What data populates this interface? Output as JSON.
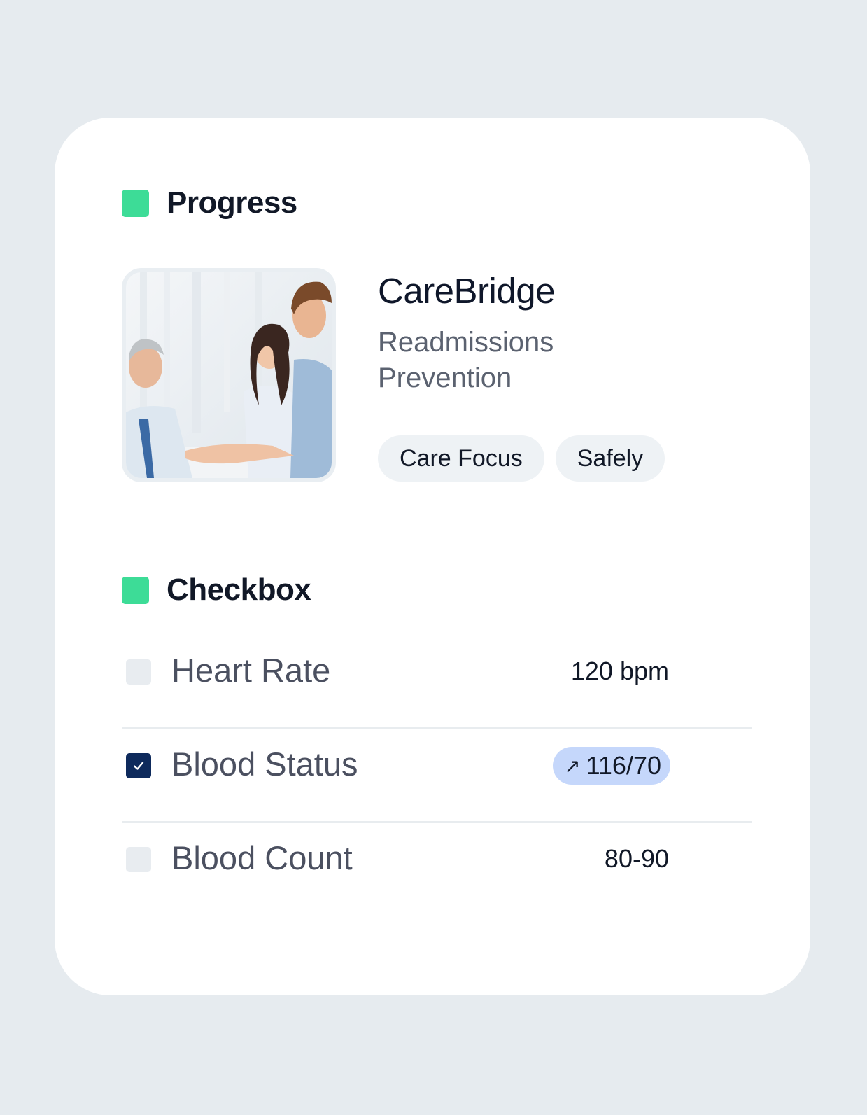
{
  "progress_section": {
    "title": "Progress",
    "app_title": "CareBridge",
    "subtitle_line1": "Readmissions",
    "subtitle_line2": "Prevention",
    "tags": [
      "Care Focus",
      "Safely"
    ]
  },
  "checkbox_section": {
    "title": "Checkbox",
    "items": [
      {
        "label": "Heart Rate",
        "value": "120 bpm",
        "checked": false
      },
      {
        "label": "Blood Status",
        "value": "116/70",
        "checked": true,
        "trend_icon": "arrow-up-right-icon"
      },
      {
        "label": "Blood Count",
        "value": "80-90",
        "checked": false
      }
    ]
  },
  "colors": {
    "background": "#e6ebef",
    "card": "#ffffff",
    "accent_green": "#3ddc97",
    "checked_box": "#0e2a5c",
    "pill_blue": "#c5d7fb"
  }
}
